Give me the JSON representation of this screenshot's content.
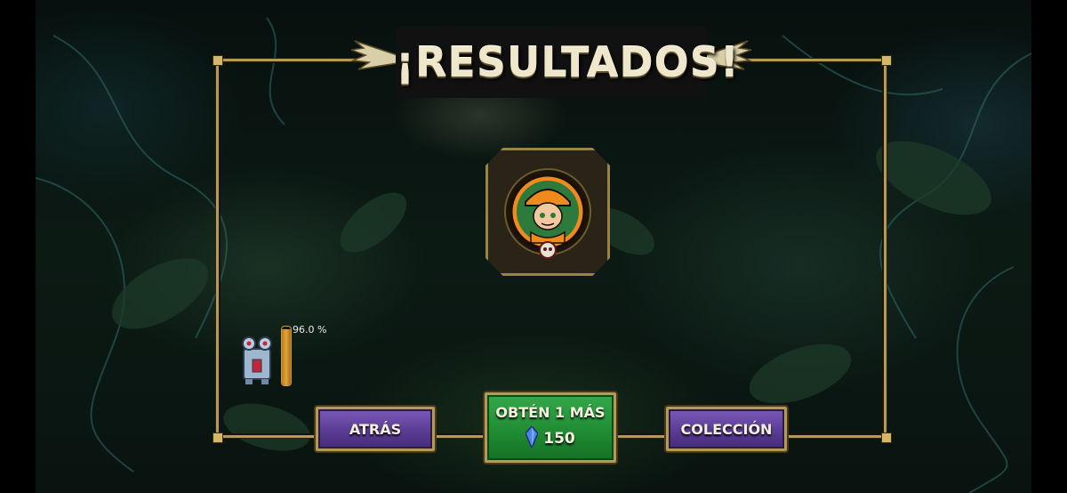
{
  "title": "¡RESULTADOS!",
  "progress": {
    "label": "96.0 %",
    "fraction": 0.96
  },
  "buttons": {
    "back": "ATRÁS",
    "get_more": "OBTÉN 1 MÁS",
    "cost": "150",
    "collection": "COLECCIÓN"
  },
  "icons": {
    "portrait": "character-portrait-icon",
    "character": "robot-character-icon",
    "gem": "blue-gem-icon",
    "skull": "skull-icon"
  },
  "colors": {
    "frame_gold": "#b59a52",
    "button_purple": "#5a3c94",
    "button_green": "#1e8a32",
    "progress_orange": "#e3a53a"
  }
}
